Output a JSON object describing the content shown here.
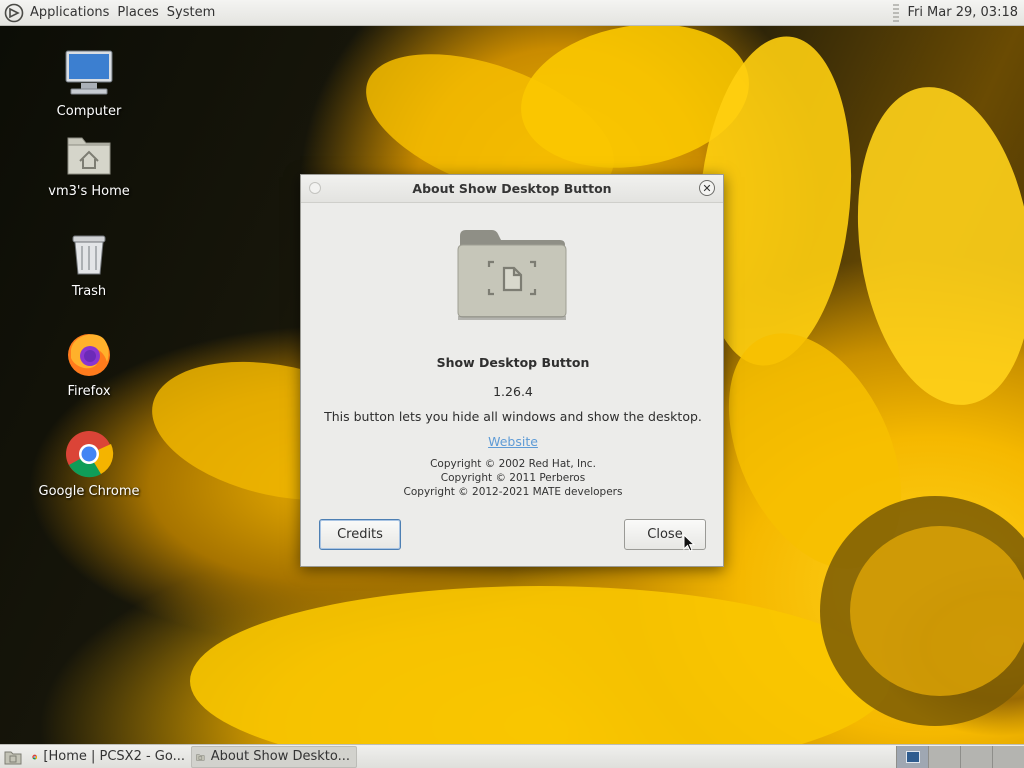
{
  "top_panel": {
    "menus": [
      "Applications",
      "Places",
      "System"
    ],
    "clock": "Fri Mar 29, 03:18"
  },
  "desktop": {
    "icons": [
      {
        "label": "Computer",
        "icon": "computer-icon"
      },
      {
        "label": "vm3's Home",
        "icon": "home-folder-icon"
      },
      {
        "label": "Trash",
        "icon": "trash-icon"
      },
      {
        "label": "Firefox",
        "icon": "firefox-icon"
      },
      {
        "label": "Google Chrome",
        "icon": "chrome-icon"
      }
    ]
  },
  "dialog": {
    "title": "About Show Desktop Button",
    "program_name": "Show Desktop Button",
    "version": "1.26.4",
    "comments": "This button lets you hide all windows and show the desktop.",
    "website_label": "Website",
    "copyright": [
      "Copyright © 2002 Red Hat, Inc.",
      "Copyright © 2011 Perberos",
      "Copyright © 2012-2021 MATE developers"
    ],
    "credits_label": "Credits",
    "close_label": "Close"
  },
  "bottom_panel": {
    "tasks": [
      {
        "label": "[Home | PCSX2 - Go...",
        "icon": "chrome-icon"
      },
      {
        "label": "About Show Deskto...",
        "icon": "show-desktop-icon",
        "active": true
      }
    ],
    "workspaces": 4,
    "active_workspace": 1
  },
  "colors": {
    "panel_bg": "#ececea",
    "link": "#5e9bd6",
    "focus_border": "#4d7fb3"
  }
}
